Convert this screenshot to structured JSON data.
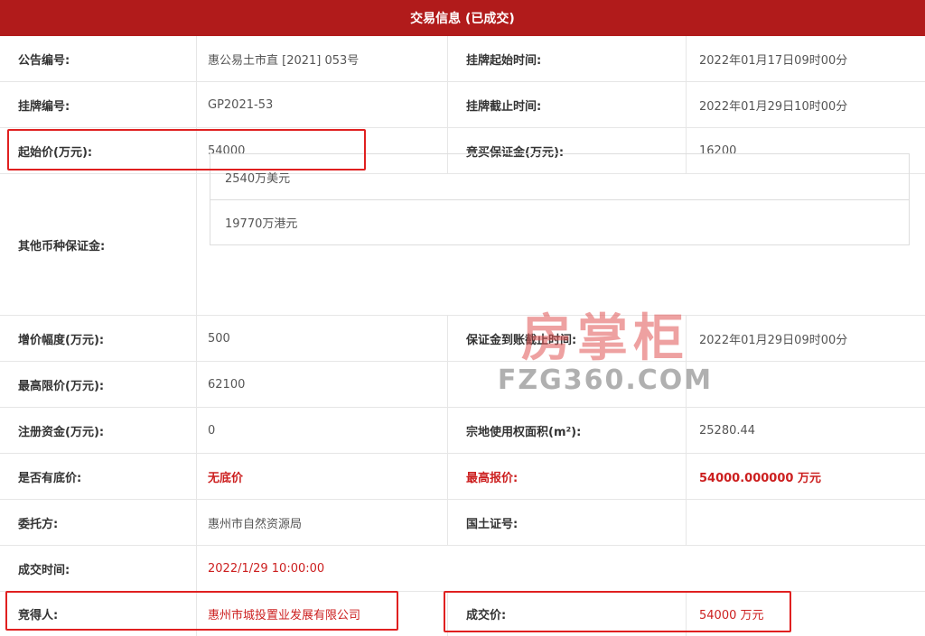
{
  "header": {
    "title": "交易信息 (已成交)"
  },
  "rows": {
    "notice_no": {
      "label": "公告编号:",
      "value": "惠公易土市直 [2021] 053号"
    },
    "listing_start": {
      "label": "挂牌起始时间:",
      "value": "2022年01月17日09时00分"
    },
    "listing_no": {
      "label": "挂牌编号:",
      "value": "GP2021-53"
    },
    "listing_end": {
      "label": "挂牌截止时间:",
      "value": "2022年01月29日10时00分"
    },
    "start_price": {
      "label": "起始价(万元):",
      "value": "54000"
    },
    "deposit": {
      "label": "竞买保证金(万元):",
      "value": "16200"
    },
    "other_deposit": {
      "label": "其他币种保证金:",
      "items": [
        "2540万美元",
        "19770万港元"
      ]
    },
    "increment": {
      "label": "增价幅度(万元):",
      "value": "500"
    },
    "deposit_deadline": {
      "label": "保证金到账截止时间:",
      "value": "2022年01月29日09时00分"
    },
    "max_price": {
      "label": "最高限价(万元):",
      "value": "62100"
    },
    "capital": {
      "label": "注册资金(万元):",
      "value": "0"
    },
    "area": {
      "label": "宗地使用权面积(m²):",
      "value": "25280.44"
    },
    "reserve": {
      "label": "是否有底价:",
      "value": "无底价"
    },
    "top_bid": {
      "label": "最高报价:",
      "value": "54000.000000 万元"
    },
    "entrusting": {
      "label": "委托方:",
      "value": "惠州市自然资源局"
    },
    "land_cert": {
      "label": "国土证号:",
      "value": ""
    },
    "deal_time": {
      "label": "成交时间:",
      "value": "2022/1/29 10:00:00"
    },
    "winner": {
      "label": "竞得人:",
      "value": "惠州市城投置业发展有限公司"
    },
    "deal_price": {
      "label": "成交价:",
      "value": "54000 万元"
    }
  },
  "watermark": {
    "cn": "房掌柜",
    "en": "FZG360.COM"
  },
  "colors": {
    "header_bg": "#b11b1b",
    "accent_red": "#cc1f1f",
    "highlight_border": "#e02020"
  }
}
